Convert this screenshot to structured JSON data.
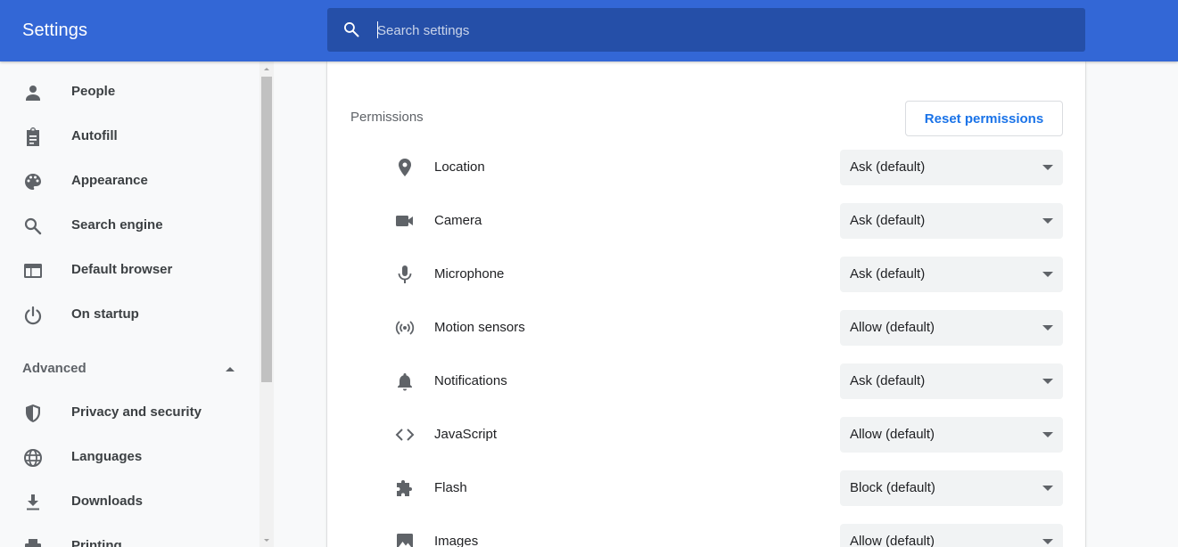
{
  "header": {
    "title": "Settings",
    "search_placeholder": "Search settings",
    "search_value": ""
  },
  "sidebar": {
    "items": [
      {
        "label": "People",
        "icon": "person-icon"
      },
      {
        "label": "Autofill",
        "icon": "clipboard-icon"
      },
      {
        "label": "Appearance",
        "icon": "palette-icon"
      },
      {
        "label": "Search engine",
        "icon": "search-icon"
      },
      {
        "label": "Default browser",
        "icon": "browser-window-icon"
      },
      {
        "label": "On startup",
        "icon": "power-icon"
      }
    ],
    "advanced_label": "Advanced",
    "advanced_items": [
      {
        "label": "Privacy and security",
        "icon": "shield-icon"
      },
      {
        "label": "Languages",
        "icon": "globe-icon"
      },
      {
        "label": "Downloads",
        "icon": "download-icon"
      },
      {
        "label": "Printing",
        "icon": "printer-icon"
      }
    ]
  },
  "permissions": {
    "title": "Permissions",
    "reset_label": "Reset permissions",
    "rows": [
      {
        "label": "Location",
        "value": "Ask (default)",
        "icon": "location-pin-icon"
      },
      {
        "label": "Camera",
        "value": "Ask (default)",
        "icon": "camera-icon"
      },
      {
        "label": "Microphone",
        "value": "Ask (default)",
        "icon": "microphone-icon"
      },
      {
        "label": "Motion sensors",
        "value": "Allow (default)",
        "icon": "motion-sensor-icon"
      },
      {
        "label": "Notifications",
        "value": "Ask (default)",
        "icon": "bell-icon"
      },
      {
        "label": "JavaScript",
        "value": "Allow (default)",
        "icon": "code-icon"
      },
      {
        "label": "Flash",
        "value": "Block (default)",
        "icon": "puzzle-icon"
      },
      {
        "label": "Images",
        "value": "Allow (default)",
        "icon": "image-icon"
      }
    ]
  },
  "colors": {
    "header_bg": "#3367d6",
    "search_bg": "#254fa8",
    "accent": "#1a73e8",
    "icon_gray": "#5f6368"
  }
}
